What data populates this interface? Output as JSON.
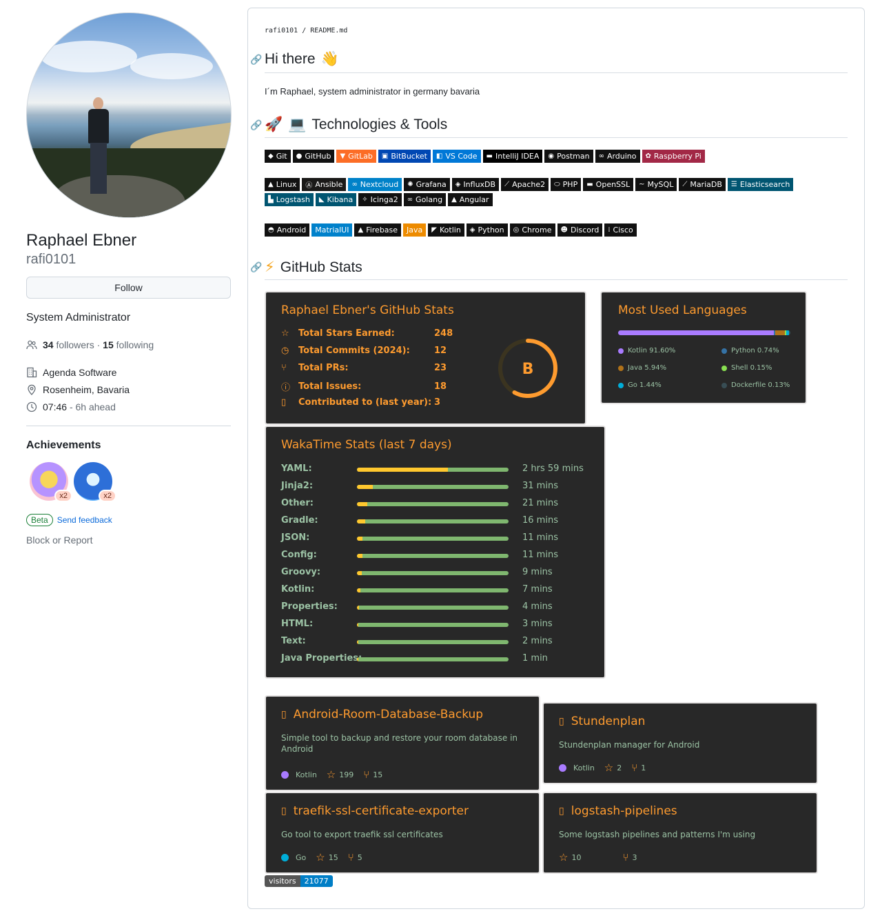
{
  "profile": {
    "name": "Raphael Ebner",
    "login": "rafi0101",
    "follow_label": "Follow",
    "bio": "System Administrator",
    "followers": "34",
    "followers_label": "followers",
    "separator": "·",
    "following": "15",
    "following_label": "following",
    "company": "Agenda Software",
    "location": "Rosenheim, Bavaria",
    "local_time": "07:46",
    "time_offset": "- 6h ahead",
    "achievements_title": "Achievements",
    "achievements": [
      {
        "name": "Starstruck",
        "count": "x2"
      },
      {
        "name": "Pull Shark",
        "count": "x2"
      }
    ],
    "beta_label": "Beta",
    "feedback_label": "Send feedback",
    "block_label": "Block or Report"
  },
  "readme": {
    "path_user": "rafi0101",
    "path_sep": "/",
    "path_file": "README.md",
    "heading_hi": "Hi there",
    "hi_emoji": "👋",
    "intro": "I´m Raphael, system administrator in germany bavaria",
    "heading_tech": "Technologies & Tools",
    "heading_stats": "GitHub Stats",
    "tech_row1": [
      {
        "label": "Git",
        "color": "#111111",
        "icon": "git-icon",
        "glyph": "◆"
      },
      {
        "label": "GitHub",
        "color": "#111111",
        "icon": "github-icon",
        "glyph": "●"
      },
      {
        "label": "GitLab",
        "color": "#fc6d26",
        "icon": "gitlab-icon",
        "glyph": "▼"
      },
      {
        "label": "BitBucket",
        "color": "#0047b3",
        "icon": "bitbucket-icon",
        "glyph": "▣"
      },
      {
        "label": "VS Code",
        "color": "#0078d7",
        "icon": "vscode-icon",
        "glyph": "◧"
      },
      {
        "label": "IntelliJ IDEA",
        "color": "#000000",
        "icon": "intellij-icon",
        "glyph": "▬"
      },
      {
        "label": "Postman",
        "color": "#111111",
        "icon": "postman-icon",
        "glyph": "◉"
      },
      {
        "label": "Arduino",
        "color": "#111111",
        "icon": "arduino-icon",
        "glyph": "∞"
      },
      {
        "label": "Raspberry Pi",
        "color": "#a22846",
        "icon": "raspberry-icon",
        "glyph": "✿"
      }
    ],
    "tech_row2": [
      {
        "label": "Linux",
        "color": "#111111",
        "icon": "linux-icon",
        "glyph": "▲"
      },
      {
        "label": "Ansible",
        "color": "#1a1918",
        "icon": "ansible-icon",
        "glyph": "Ⓐ"
      },
      {
        "label": "Nextcloud",
        "color": "#0082c9",
        "icon": "nextcloud-icon",
        "glyph": "∞"
      },
      {
        "label": "Grafana",
        "color": "#111111",
        "icon": "grafana-icon",
        "glyph": "✺"
      },
      {
        "label": "InfluxDB",
        "color": "#111111",
        "icon": "influxdb-icon",
        "glyph": "◈"
      },
      {
        "label": "Apache2",
        "color": "#111111",
        "icon": "apache-icon",
        "glyph": "⟋"
      },
      {
        "label": "PHP",
        "color": "#111111",
        "icon": "php-icon",
        "glyph": "⬭"
      },
      {
        "label": "OpenSSL",
        "color": "#111111",
        "icon": "openssl-icon",
        "glyph": "▬"
      },
      {
        "label": "MySQL",
        "color": "#111111",
        "icon": "mysql-icon",
        "glyph": "~"
      },
      {
        "label": "MariaDB",
        "color": "#111111",
        "icon": "mariadb-icon",
        "glyph": "⟋"
      },
      {
        "label": "Elasticsearch",
        "color": "#005571",
        "icon": "elasticsearch-icon",
        "glyph": "☰"
      },
      {
        "label": "Logstash",
        "color": "#005571",
        "icon": "logstash-icon",
        "glyph": "▙"
      },
      {
        "label": "Kibana",
        "color": "#005571",
        "icon": "kibana-icon",
        "glyph": "◣"
      },
      {
        "label": "Icinga2",
        "color": "#111111",
        "icon": "icinga-icon",
        "glyph": "✧"
      },
      {
        "label": "Golang",
        "color": "#111111",
        "icon": "golang-icon",
        "glyph": "∞"
      },
      {
        "label": "Angular",
        "color": "#111111",
        "icon": "angular-icon",
        "glyph": "▲"
      }
    ],
    "tech_row3": [
      {
        "label": "Android",
        "color": "#111111",
        "icon": "android-icon",
        "glyph": "◓"
      },
      {
        "label": "MatrialUI",
        "color": "#0081cb",
        "icon": "materialui-icon",
        "glyph": ""
      },
      {
        "label": "Firebase",
        "color": "#111111",
        "icon": "firebase-icon",
        "glyph": "▲"
      },
      {
        "label": "Java",
        "color": "#ed8b00",
        "icon": "java-icon",
        "glyph": ""
      },
      {
        "label": "Kotlin",
        "color": "#111111",
        "icon": "kotlin-icon",
        "glyph": "◤"
      },
      {
        "label": "Python",
        "color": "#111111",
        "icon": "python-icon",
        "glyph": "◈"
      },
      {
        "label": "Chrome",
        "color": "#111111",
        "icon": "chrome-icon",
        "glyph": "◎"
      },
      {
        "label": "Discord",
        "color": "#111111",
        "icon": "discord-icon",
        "glyph": "☻"
      },
      {
        "label": "Cisco",
        "color": "#111111",
        "icon": "cisco-icon",
        "glyph": "⁞"
      }
    ],
    "visitors_label": "visitors",
    "visitors_count": "21077"
  },
  "github_stats": {
    "title": "Raphael Ebner's GitHub Stats",
    "grade": "B",
    "grade_progress": 0.58,
    "items": [
      {
        "label": "Total Stars Earned:",
        "value": "248",
        "icon": "star-icon",
        "glyph": "☆"
      },
      {
        "label": "Total Commits (2024):",
        "value": "12",
        "icon": "history-icon",
        "glyph": "◷"
      },
      {
        "label": "Total PRs:",
        "value": "23",
        "icon": "pull-request-icon",
        "glyph": "⑂"
      },
      {
        "label": "Total Issues:",
        "value": "18",
        "icon": "issue-icon",
        "glyph": "ⓘ"
      },
      {
        "label": "Contributed to (last year):",
        "value": "3",
        "icon": "repo-icon",
        "glyph": "▯"
      }
    ]
  },
  "languages": {
    "title": "Most Used Languages",
    "items": [
      {
        "label": "Kotlin 91.60%",
        "percent": 91.6,
        "color": "#a97bff"
      },
      {
        "label": "Python 0.74%",
        "percent": 0.74,
        "color": "#3572a5"
      },
      {
        "label": "Java 5.94%",
        "percent": 5.94,
        "color": "#b07219"
      },
      {
        "label": "Shell 0.15%",
        "percent": 0.15,
        "color": "#89e051"
      },
      {
        "label": "Go 1.44%",
        "percent": 1.44,
        "color": "#00add8"
      },
      {
        "label": "Dockerfile 0.13%",
        "percent": 0.13,
        "color": "#384d54"
      }
    ]
  },
  "wakatime": {
    "title": "WakaTime Stats (last 7 days)",
    "items": [
      {
        "label": "YAML:",
        "time": "2 hrs 59 mins",
        "fraction": 0.6
      },
      {
        "label": "Jinja2:",
        "time": "31 mins",
        "fraction": 0.104
      },
      {
        "label": "Other:",
        "time": "21 mins",
        "fraction": 0.07
      },
      {
        "label": "Gradle:",
        "time": "16 mins",
        "fraction": 0.054
      },
      {
        "label": "JSON:",
        "time": "11 mins",
        "fraction": 0.037
      },
      {
        "label": "Config:",
        "time": "11 mins",
        "fraction": 0.037
      },
      {
        "label": "Groovy:",
        "time": "9 mins",
        "fraction": 0.03
      },
      {
        "label": "Kotlin:",
        "time": "7 mins",
        "fraction": 0.023
      },
      {
        "label": "Properties:",
        "time": "4 mins",
        "fraction": 0.013
      },
      {
        "label": "HTML:",
        "time": "3 mins",
        "fraction": 0.01
      },
      {
        "label": "Text:",
        "time": "2 mins",
        "fraction": 0.007
      },
      {
        "label": "Java Properties:",
        "time": "1 min",
        "fraction": 0.004
      }
    ]
  },
  "repos": [
    {
      "name": "Android-Room-Database-Backup",
      "desc": "Simple tool to backup and restore your room database in Android",
      "lang": "Kotlin",
      "lang_color": "#a97bff",
      "stars": "199",
      "forks": "15"
    },
    {
      "name": "Stundenplan",
      "desc": "Stundenplan manager for Android",
      "lang": "Kotlin",
      "lang_color": "#a97bff",
      "stars": "2",
      "forks": "1"
    },
    {
      "name": "traefik-ssl-certificate-exporter",
      "desc": "Go tool to export traefik ssl certificates",
      "lang": "Go",
      "lang_color": "#00add8",
      "stars": "15",
      "forks": "5"
    },
    {
      "name": "logstash-pipelines",
      "desc": "Some logstash pipelines and patterns I'm using",
      "lang": "",
      "lang_color": "",
      "stars": "10",
      "forks": "3"
    }
  ]
}
